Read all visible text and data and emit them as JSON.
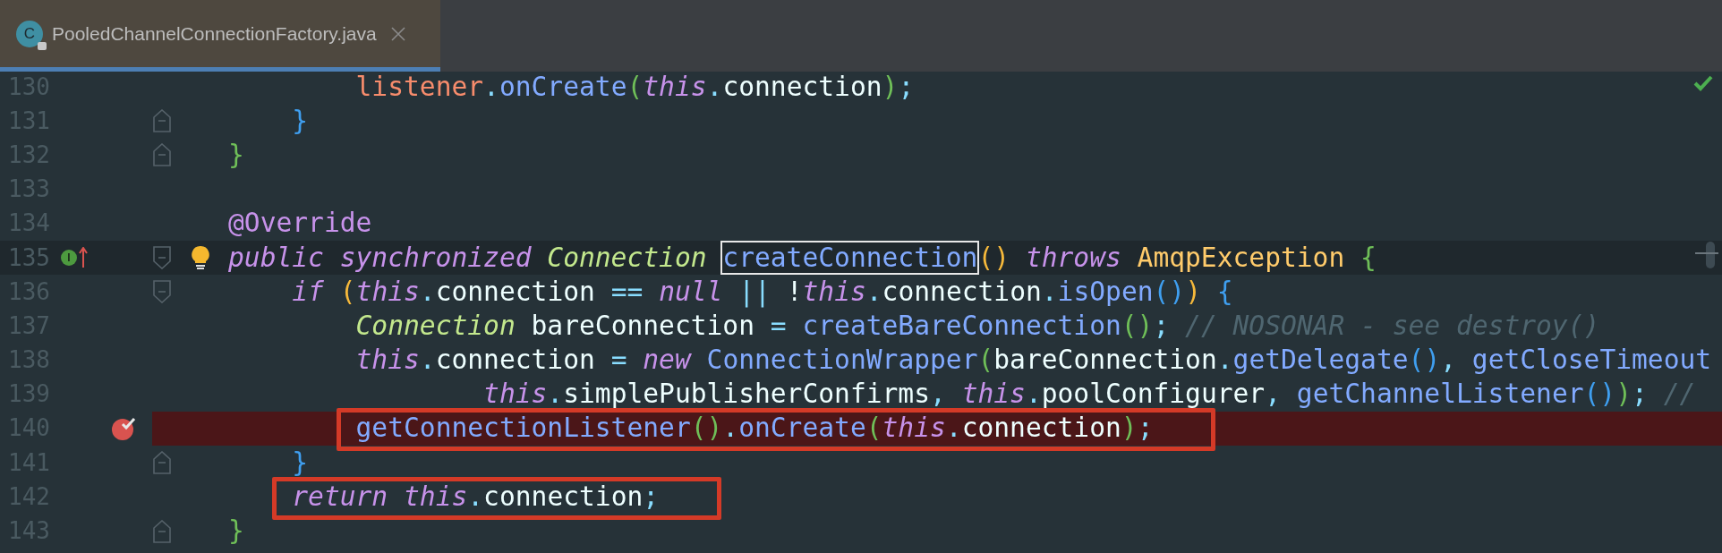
{
  "tab": {
    "icon_letter": "C",
    "title": "PooledChannelConnectionFactory.java",
    "selected": true
  },
  "editor": {
    "inspection_ok": true,
    "lines": [
      {
        "number": "130",
        "tokens": [
          {
            "text": "        listener",
            "kind": "param"
          },
          {
            "text": ".",
            "kind": "punct"
          },
          {
            "text": "onCreate",
            "kind": "method"
          },
          {
            "text": "(",
            "kind": "paren-green"
          },
          {
            "text": "this",
            "kind": "keyword"
          },
          {
            "text": ".",
            "kind": "punct"
          },
          {
            "text": "connection",
            "kind": "field"
          },
          {
            "text": ")",
            "kind": "paren-green"
          },
          {
            "text": ";",
            "kind": "punct"
          }
        ]
      },
      {
        "number": "131",
        "fold_close": true,
        "tokens": [
          {
            "text": "    }",
            "kind": "paren-blue"
          }
        ]
      },
      {
        "number": "132",
        "fold_close": true,
        "tokens": [
          {
            "text": "}",
            "kind": "paren-green"
          }
        ]
      },
      {
        "number": "133"
      },
      {
        "number": "134",
        "tokens": [
          {
            "text": "@Override",
            "kind": "annotation"
          }
        ]
      },
      {
        "number": "135",
        "current": true,
        "bulb": true,
        "fold_open": true,
        "markers": [
          {
            "kind": "implements",
            "letter": "I"
          },
          {
            "kind": "override"
          }
        ],
        "tokens": [
          {
            "text": "public ",
            "kind": "keyword"
          },
          {
            "text": "synchronized ",
            "kind": "keyword"
          },
          {
            "text": "Connection ",
            "kind": "type"
          },
          {
            "text": "createConnection",
            "kind": "method",
            "boxed": true
          },
          {
            "text": "() ",
            "kind": "paren-yellow"
          },
          {
            "text": "throws ",
            "kind": "keyword"
          },
          {
            "text": "AmqpException ",
            "kind": "class"
          },
          {
            "text": "{",
            "kind": "paren-green"
          }
        ]
      },
      {
        "number": "136",
        "fold_open": true,
        "tokens": [
          {
            "text": "    if ",
            "kind": "keyword"
          },
          {
            "text": "(",
            "kind": "paren-yellow"
          },
          {
            "text": "this",
            "kind": "keyword"
          },
          {
            "text": ".",
            "kind": "punct"
          },
          {
            "text": "connection ",
            "kind": "field"
          },
          {
            "text": "== ",
            "kind": "punct"
          },
          {
            "text": "null ",
            "kind": "keyword"
          },
          {
            "text": "|| ",
            "kind": "punct"
          },
          {
            "text": "!",
            "kind": "field"
          },
          {
            "text": "this",
            "kind": "keyword"
          },
          {
            "text": ".",
            "kind": "punct"
          },
          {
            "text": "connection",
            "kind": "field"
          },
          {
            "text": ".",
            "kind": "punct"
          },
          {
            "text": "isOpen",
            "kind": "method"
          },
          {
            "text": "()",
            "kind": "paren-blue"
          },
          {
            "text": ") ",
            "kind": "paren-yellow"
          },
          {
            "text": "{",
            "kind": "paren-blue"
          }
        ]
      },
      {
        "number": "137",
        "tokens": [
          {
            "text": "        Connection ",
            "kind": "type"
          },
          {
            "text": "bareConnection ",
            "kind": "field"
          },
          {
            "text": "= ",
            "kind": "punct"
          },
          {
            "text": "createBareConnection",
            "kind": "method"
          },
          {
            "text": "()",
            "kind": "paren-green"
          },
          {
            "text": "; ",
            "kind": "punct"
          },
          {
            "text": "// NOSONAR - see destroy()",
            "kind": "comment"
          }
        ]
      },
      {
        "number": "138",
        "tokens": [
          {
            "text": "        this",
            "kind": "keyword"
          },
          {
            "text": ".",
            "kind": "punct"
          },
          {
            "text": "connection ",
            "kind": "field"
          },
          {
            "text": "= ",
            "kind": "punct"
          },
          {
            "text": "new ",
            "kind": "keyword"
          },
          {
            "text": "ConnectionWrapper",
            "kind": "method"
          },
          {
            "text": "(",
            "kind": "paren-green"
          },
          {
            "text": "bareConnection",
            "kind": "field"
          },
          {
            "text": ".",
            "kind": "punct"
          },
          {
            "text": "getDelegate",
            "kind": "method"
          },
          {
            "text": "()",
            "kind": "paren-blue"
          },
          {
            "text": ", ",
            "kind": "punct"
          },
          {
            "text": "getCloseTimeout",
            "kind": "method"
          }
        ]
      },
      {
        "number": "139",
        "tokens": [
          {
            "text": "                this",
            "kind": "keyword"
          },
          {
            "text": ".",
            "kind": "punct"
          },
          {
            "text": "simplePublisherConfirms",
            "kind": "field"
          },
          {
            "text": ", ",
            "kind": "punct"
          },
          {
            "text": "this",
            "kind": "keyword"
          },
          {
            "text": ".",
            "kind": "punct"
          },
          {
            "text": "poolConfigurer",
            "kind": "field"
          },
          {
            "text": ", ",
            "kind": "punct"
          },
          {
            "text": "getChannelListener",
            "kind": "method"
          },
          {
            "text": "()",
            "kind": "paren-blue"
          },
          {
            "text": ")",
            "kind": "paren-green"
          },
          {
            "text": "; ",
            "kind": "punct"
          },
          {
            "text": "//",
            "kind": "comment"
          }
        ]
      },
      {
        "number": "140",
        "breakpoint": true,
        "framed": true,
        "tokens": [
          {
            "text": "        getConnectionListener",
            "kind": "method"
          },
          {
            "text": "()",
            "kind": "paren-green"
          },
          {
            "text": ".",
            "kind": "punct"
          },
          {
            "text": "onCreate",
            "kind": "method"
          },
          {
            "text": "(",
            "kind": "paren-green"
          },
          {
            "text": "this",
            "kind": "keyword"
          },
          {
            "text": ".",
            "kind": "punct"
          },
          {
            "text": "connection",
            "kind": "field"
          },
          {
            "text": ")",
            "kind": "paren-green"
          },
          {
            "text": ";",
            "kind": "punct"
          }
        ]
      },
      {
        "number": "141",
        "fold_close": true,
        "tokens": [
          {
            "text": "    }",
            "kind": "paren-blue"
          }
        ]
      },
      {
        "number": "142",
        "framed": true,
        "tokens": [
          {
            "text": "    return ",
            "kind": "keyword"
          },
          {
            "text": "this",
            "kind": "keyword"
          },
          {
            "text": ".",
            "kind": "punct"
          },
          {
            "text": "connection",
            "kind": "field"
          },
          {
            "text": ";",
            "kind": "punct"
          }
        ]
      },
      {
        "number": "143",
        "fold_close": true,
        "tokens": [
          {
            "text": "}",
            "kind": "paren-green"
          }
        ]
      }
    ]
  }
}
